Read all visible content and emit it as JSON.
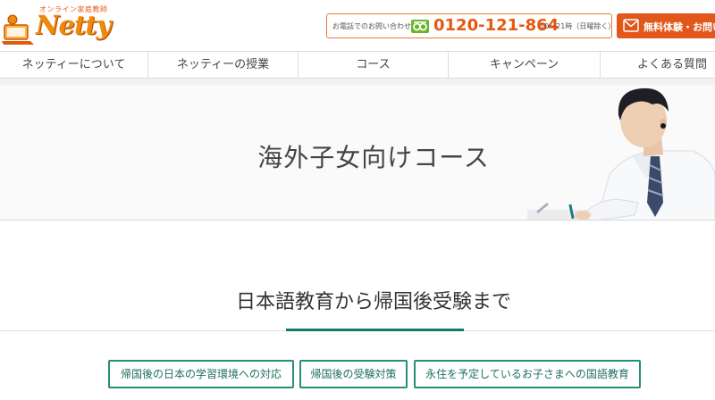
{
  "header": {
    "logo": {
      "tagline": "オンライン家庭教師",
      "brand": "Netty"
    },
    "phone": {
      "caption": "お電話でのお問い合わせ",
      "number": "0120-121-864",
      "hours": "10～21時（日曜除く）"
    },
    "trial_button_label": "無料体験・お問い"
  },
  "nav": {
    "items": [
      {
        "label": "ネッティーについて"
      },
      {
        "label": "ネッティーの授業"
      },
      {
        "label": "コース"
      },
      {
        "label": "キャンペーン"
      },
      {
        "label": "よくある質問"
      }
    ]
  },
  "hero": {
    "title": "海外子女向けコース"
  },
  "section": {
    "title": "日本語教育から帰国後受験まで",
    "tabs": [
      {
        "label": "帰国後の日本の学習環境への対応"
      },
      {
        "label": "帰国後の受験対策"
      },
      {
        "label": "永住を予定しているお子さまへの国語教育"
      }
    ]
  },
  "colors": {
    "accent_orange": "#e2571a",
    "phone_orange": "#e6570f",
    "teal": "#117a68",
    "tab_border": "#2a8d7a"
  },
  "icons": [
    "free-dial-icon",
    "mail-icon",
    "logo-mark-icon"
  ]
}
